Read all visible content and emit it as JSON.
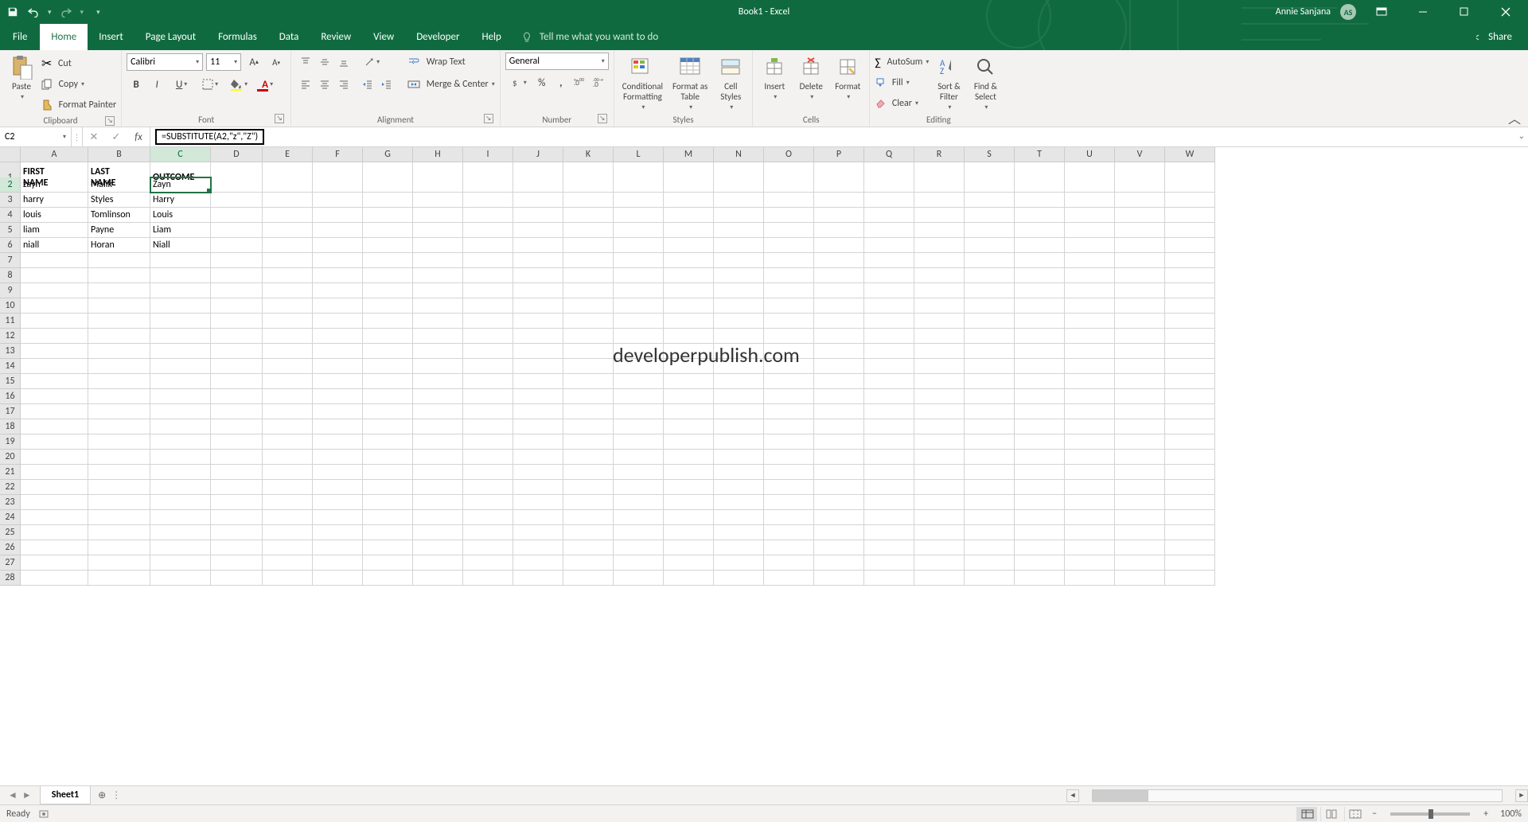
{
  "titlebar": {
    "title": "Book1 - Excel",
    "user_name": "Annie Sanjana",
    "user_initials": "AS"
  },
  "tabs": {
    "file": "File",
    "home": "Home",
    "insert": "Insert",
    "pagelayout": "Page Layout",
    "formulas": "Formulas",
    "data": "Data",
    "review": "Review",
    "view": "View",
    "developer": "Developer",
    "help": "Help",
    "tellme": "Tell me what you want to do",
    "share": "Share"
  },
  "ribbon": {
    "clipboard": {
      "label": "Clipboard",
      "paste": "Paste",
      "cut": "Cut",
      "copy": "Copy",
      "format_painter": "Format Painter"
    },
    "font": {
      "label": "Font",
      "name": "Calibri",
      "size": "11"
    },
    "alignment": {
      "label": "Alignment",
      "wrap": "Wrap Text",
      "merge": "Merge & Center"
    },
    "number": {
      "label": "Number",
      "format": "General"
    },
    "styles": {
      "label": "Styles",
      "cond": "Conditional\nFormatting",
      "table": "Format as\nTable",
      "cell": "Cell\nStyles"
    },
    "cells": {
      "label": "Cells",
      "insert": "Insert",
      "delete": "Delete",
      "format": "Format"
    },
    "editing": {
      "label": "Editing",
      "autosum": "AutoSum",
      "fill": "Fill",
      "clear": "Clear",
      "sort": "Sort &\nFilter",
      "find": "Find &\nSelect"
    }
  },
  "namebox": "C2",
  "formula": "=SUBSTITUTE(A2,\"z\",\"Z\")",
  "columns": [
    "A",
    "B",
    "C",
    "D",
    "E",
    "F",
    "G",
    "H",
    "I",
    "J",
    "K",
    "L",
    "M",
    "N",
    "O",
    "P",
    "Q",
    "R",
    "S",
    "T",
    "U",
    "V",
    "W"
  ],
  "rows": [
    "1",
    "2",
    "3",
    "4",
    "5",
    "6",
    "7",
    "8",
    "9",
    "10",
    "11",
    "12",
    "13",
    "14",
    "15",
    "16",
    "17",
    "18",
    "19",
    "20",
    "21",
    "22",
    "23",
    "24",
    "25",
    "26",
    "27",
    "28"
  ],
  "cells": {
    "A1": "FIRST NAME",
    "B1": "LAST NAME",
    "C1": "OUTCOME",
    "A2": "zayn",
    "B2": "Malik",
    "C2": "Zayn",
    "A3": "harry",
    "B3": "Styles",
    "C3": "Harry",
    "A4": "louis",
    "B4": "Tomlinson",
    "C4": "Louis",
    "A5": "liam",
    "B5": "Payne",
    "C5": "Liam",
    "A6": "niall",
    "B6": "Horan",
    "C6": "Niall"
  },
  "watermark": "developerpublish.com",
  "sheet": {
    "name": "Sheet1"
  },
  "statusbar": {
    "ready": "Ready",
    "zoom": "100%"
  }
}
